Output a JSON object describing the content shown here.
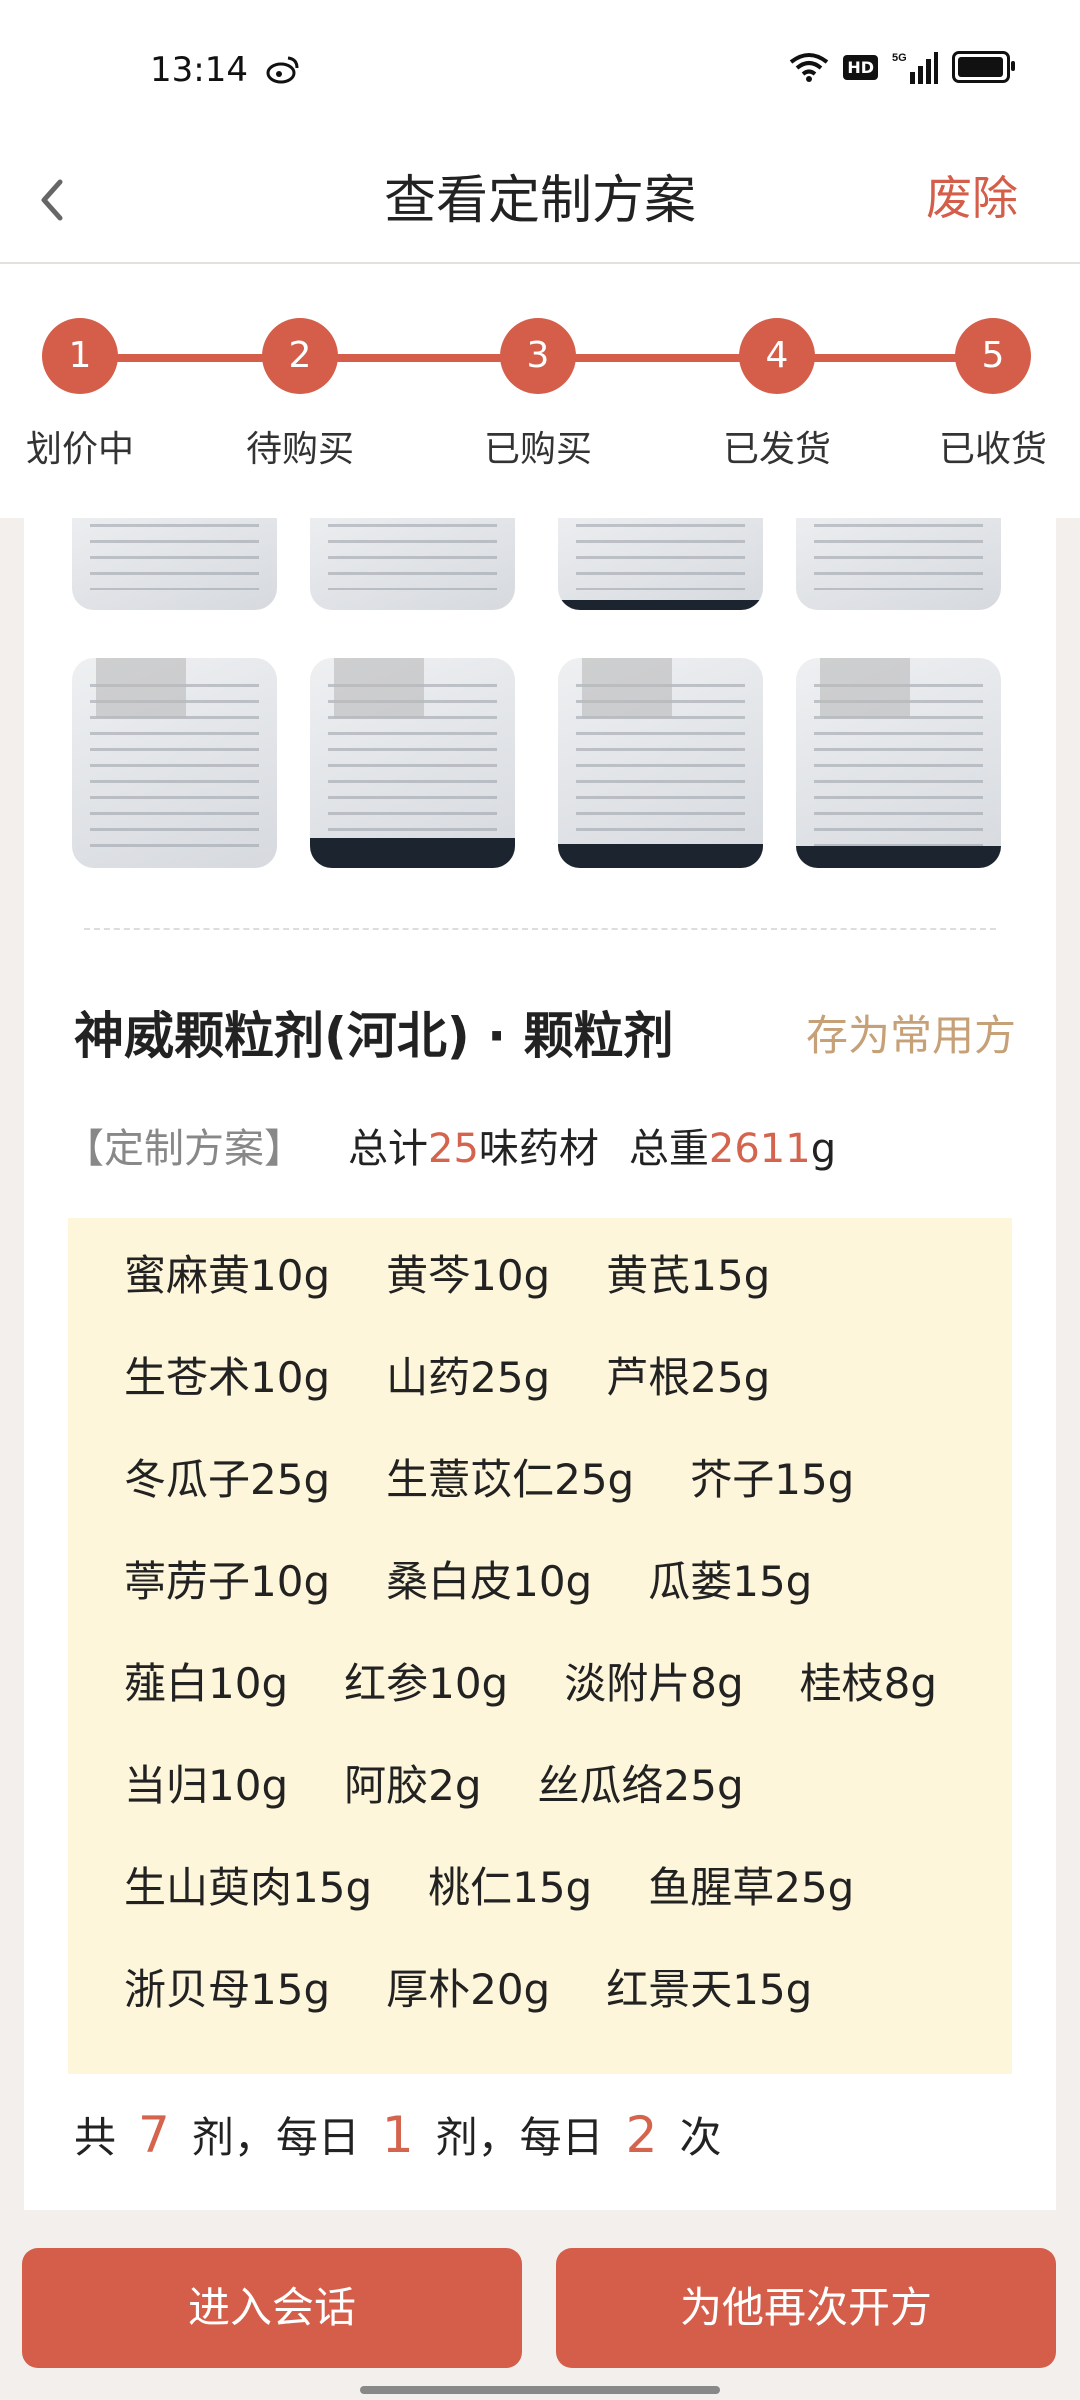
{
  "status_bar": {
    "time": "13:14",
    "hd": "HD",
    "network": "5G"
  },
  "header": {
    "title": "查看定制方案",
    "action": "废除"
  },
  "progress": {
    "steps": [
      {
        "number": "1",
        "label": "划价中"
      },
      {
        "number": "2",
        "label": "待购买"
      },
      {
        "number": "3",
        "label": "已购买"
      },
      {
        "number": "4",
        "label": "已发货"
      },
      {
        "number": "5",
        "label": "已收货"
      }
    ]
  },
  "prescription": {
    "name": "神威颗粒剂(河北) · 颗粒剂",
    "save_action": "存为常用方",
    "tag": "【定制方案】",
    "summary": {
      "count_prefix": "总计",
      "count": "25",
      "count_suffix": "味药材",
      "weight_prefix": "总重",
      "weight": "2611",
      "weight_unit": "g"
    },
    "herb_rows": [
      [
        "蜜麻黄10g",
        "黄芩10g",
        "黄芪15g"
      ],
      [
        "生苍术10g",
        "山药25g",
        "芦根25g"
      ],
      [
        "冬瓜子25g",
        "生薏苡仁25g",
        "芥子15g"
      ],
      [
        "葶苈子10g",
        "桑白皮10g",
        "瓜蒌15g"
      ],
      [
        "薤白10g",
        "红参10g",
        "淡附片8g",
        "桂枝8g"
      ],
      [
        "当归10g",
        "阿胶2g",
        "丝瓜络25g"
      ],
      [
        "生山萸肉15g",
        "桃仁15g",
        "鱼腥草25g"
      ],
      [
        "浙贝母15g",
        "厚朴20g",
        "红景天15g"
      ]
    ],
    "dosage": {
      "p1": "共",
      "doses": "7",
      "p2": "剂，每日",
      "per_day": "1",
      "p3": "剂，每日",
      "times": "2",
      "p4": "次"
    }
  },
  "buttons": {
    "chat": "进入会话",
    "represcribe": "为他再次开方"
  },
  "colors": {
    "accent": "#d45e49",
    "save": "#c6a077",
    "herb_bg": "#fdf6db"
  }
}
